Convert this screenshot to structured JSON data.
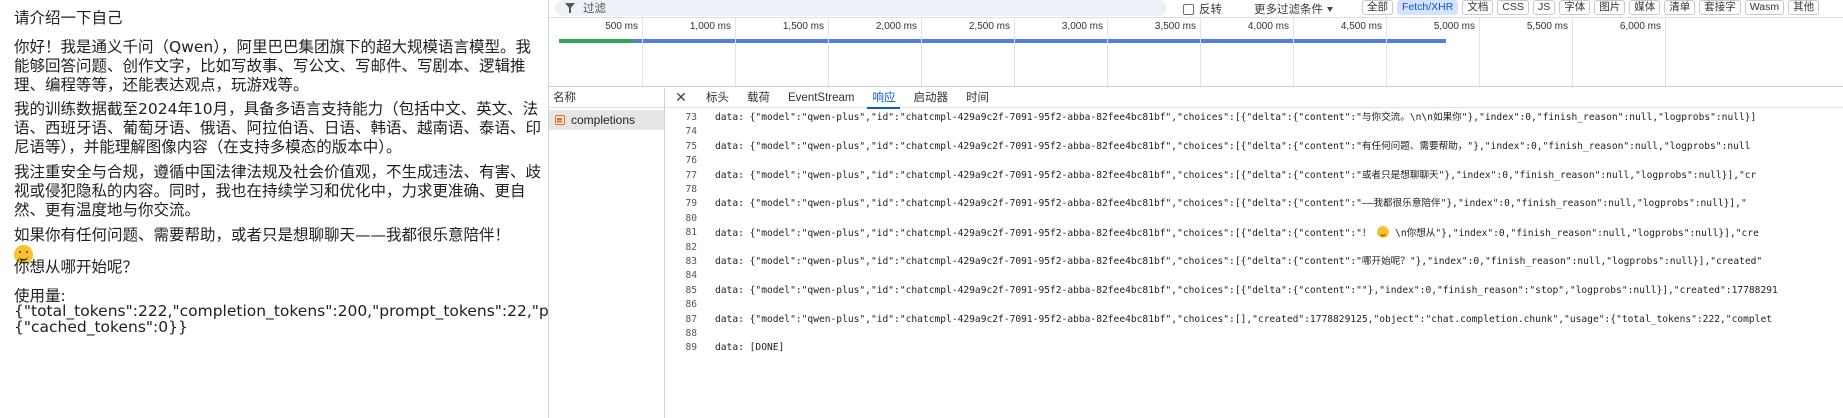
{
  "chat": {
    "title": "请介绍一下自己",
    "para1": "你好！我是通义千问（Qwen），阿里巴巴集团旗下的超大规模语言模型。我能够回答问题、创作文字，比如写故事、写公文、写邮件、写剧本、逻辑推理、编程等等，还能表达观点，玩游戏等。",
    "para2": "我的训练数据截至2024年10月，具备多语言支持能力（包括中文、英文、法语、西班牙语、葡萄牙语、俄语、阿拉伯语、日语、韩语、越南语、泰语、印尼语等），并能理解图像内容（在支持多模态的版本中）。",
    "para3": "我注重安全与合规，遵循中国法律法规及社会价值观，不生成违法、有害、歧视或侵犯隐私的内容。同时，我也在持续学习和优化中，力求更准确、更自然、更有温度地与你交流。",
    "para4": "如果你有任何问题、需要帮助，或者只是想聊聊天——我都很乐意陪伴！",
    "para4_emoji": "smiling-face-icon",
    "para5": "你想从哪开始呢？",
    "usage_label": "使用量:",
    "usage_line1": "{\"total_tokens\":222,\"completion_tokens\":200,\"prompt_tokens\":22,\"prompt_tokens_details\":",
    "usage_line2": "{\"cached_tokens\":0}}"
  },
  "devtools": {
    "filter": {
      "icon": "funnel-icon",
      "placeholder": "过滤"
    },
    "invert_label": "反转",
    "more_filters_label": "更多过滤条件",
    "type_chips": [
      "全部",
      "Fetch/XHR",
      "文档",
      "CSS",
      "JS",
      "字体",
      "图片",
      "媒体",
      "清单",
      "套接字",
      "Wasm",
      "其他"
    ],
    "active_chip": "Fetch/XHR",
    "timeline_ticks": [
      "500 ms",
      "1,000 ms",
      "1,500 ms",
      "2,000 ms",
      "2,500 ms",
      "3,000 ms",
      "3,500 ms",
      "4,000 ms",
      "4,500 ms",
      "5,000 ms",
      "5,500 ms",
      "6,000 ms"
    ],
    "names_header": "名称",
    "request_name": "completions",
    "tabs": [
      "标头",
      "载荷",
      "EventStream",
      "响应",
      "启动器",
      "时间"
    ],
    "active_tab": "响应",
    "colors": {
      "accent": "#0b57d0",
      "waiting": "#31a852",
      "download": "#4d7fe7"
    },
    "response_lines": [
      {
        "n": "73",
        "text": "data: {\"model\":\"qwen-plus\",\"id\":\"chatcmpl-429a9c2f-7091-95f2-abba-82fee4bc81bf\",\"choices\":[{\"delta\":{\"content\":\"与你交流。\\n\\n如果你\"},\"index\":0,\"finish_reason\":null,\"logprobs\":null}]"
      },
      {
        "n": "74",
        "text": ""
      },
      {
        "n": "75",
        "text": "data: {\"model\":\"qwen-plus\",\"id\":\"chatcmpl-429a9c2f-7091-95f2-abba-82fee4bc81bf\",\"choices\":[{\"delta\":{\"content\":\"有任何问题、需要帮助，\"},\"index\":0,\"finish_reason\":null,\"logprobs\":null"
      },
      {
        "n": "76",
        "text": ""
      },
      {
        "n": "77",
        "text": "data: {\"model\":\"qwen-plus\",\"id\":\"chatcmpl-429a9c2f-7091-95f2-abba-82fee4bc81bf\",\"choices\":[{\"delta\":{\"content\":\"或者只是想聊聊天\"},\"index\":0,\"finish_reason\":null,\"logprobs\":null}],\"cr"
      },
      {
        "n": "78",
        "text": ""
      },
      {
        "n": "79",
        "text": "data: {\"model\":\"qwen-plus\",\"id\":\"chatcmpl-429a9c2f-7091-95f2-abba-82fee4bc81bf\",\"choices\":[{\"delta\":{\"content\":\"——我都很乐意陪伴\"},\"index\":0,\"finish_reason\":null,\"logprobs\":null}],\""
      },
      {
        "n": "80",
        "text": ""
      },
      {
        "n": "81",
        "text_a": "data: {\"model\":\"qwen-plus\",\"id\":\"chatcmpl-429a9c2f-7091-95f2-abba-82fee4bc81bf\",\"choices\":[{\"delta\":{\"content\":\"！",
        "text_b": " \\n你想从\"},\"index\":0,\"finish_reason\":null,\"logprobs\":null}],\"cre"
      },
      {
        "n": "82",
        "text": ""
      },
      {
        "n": "83",
        "text": "data: {\"model\":\"qwen-plus\",\"id\":\"chatcmpl-429a9c2f-7091-95f2-abba-82fee4bc81bf\",\"choices\":[{\"delta\":{\"content\":\"哪开始呢？\"},\"index\":0,\"finish_reason\":null,\"logprobs\":null}],\"created\""
      },
      {
        "n": "84",
        "text": ""
      },
      {
        "n": "85",
        "text": "data: {\"model\":\"qwen-plus\",\"id\":\"chatcmpl-429a9c2f-7091-95f2-abba-82fee4bc81bf\",\"choices\":[{\"delta\":{\"content\":\"\"},\"index\":0,\"finish_reason\":\"stop\",\"logprobs\":null}],\"created\":17788291"
      },
      {
        "n": "86",
        "text": ""
      },
      {
        "n": "87",
        "text": "data: {\"model\":\"qwen-plus\",\"id\":\"chatcmpl-429a9c2f-7091-95f2-abba-82fee4bc81bf\",\"choices\":[],\"created\":1778829125,\"object\":\"chat.completion.chunk\",\"usage\":{\"total_tokens\":222,\"complet"
      },
      {
        "n": "88",
        "text": ""
      },
      {
        "n": "89",
        "text": "data: [DONE]"
      }
    ]
  }
}
